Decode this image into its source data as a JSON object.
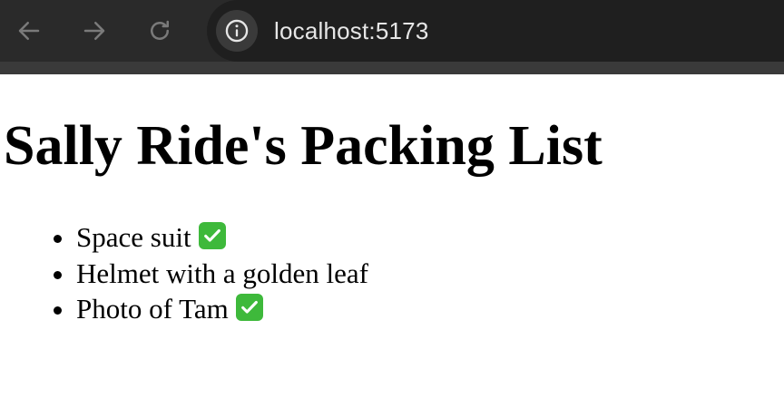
{
  "browser": {
    "url": "localhost:5173",
    "icons": {
      "back": "arrow-left-icon",
      "forward": "arrow-right-icon",
      "reload": "reload-icon",
      "site_info": "info-icon"
    }
  },
  "page": {
    "title": "Sally Ride's Packing List",
    "items": [
      {
        "name": "Space suit",
        "packed": true
      },
      {
        "name": "Helmet with a golden leaf",
        "packed": false
      },
      {
        "name": "Photo of Tam",
        "packed": true
      }
    ],
    "check_color": "#3eb93b"
  }
}
